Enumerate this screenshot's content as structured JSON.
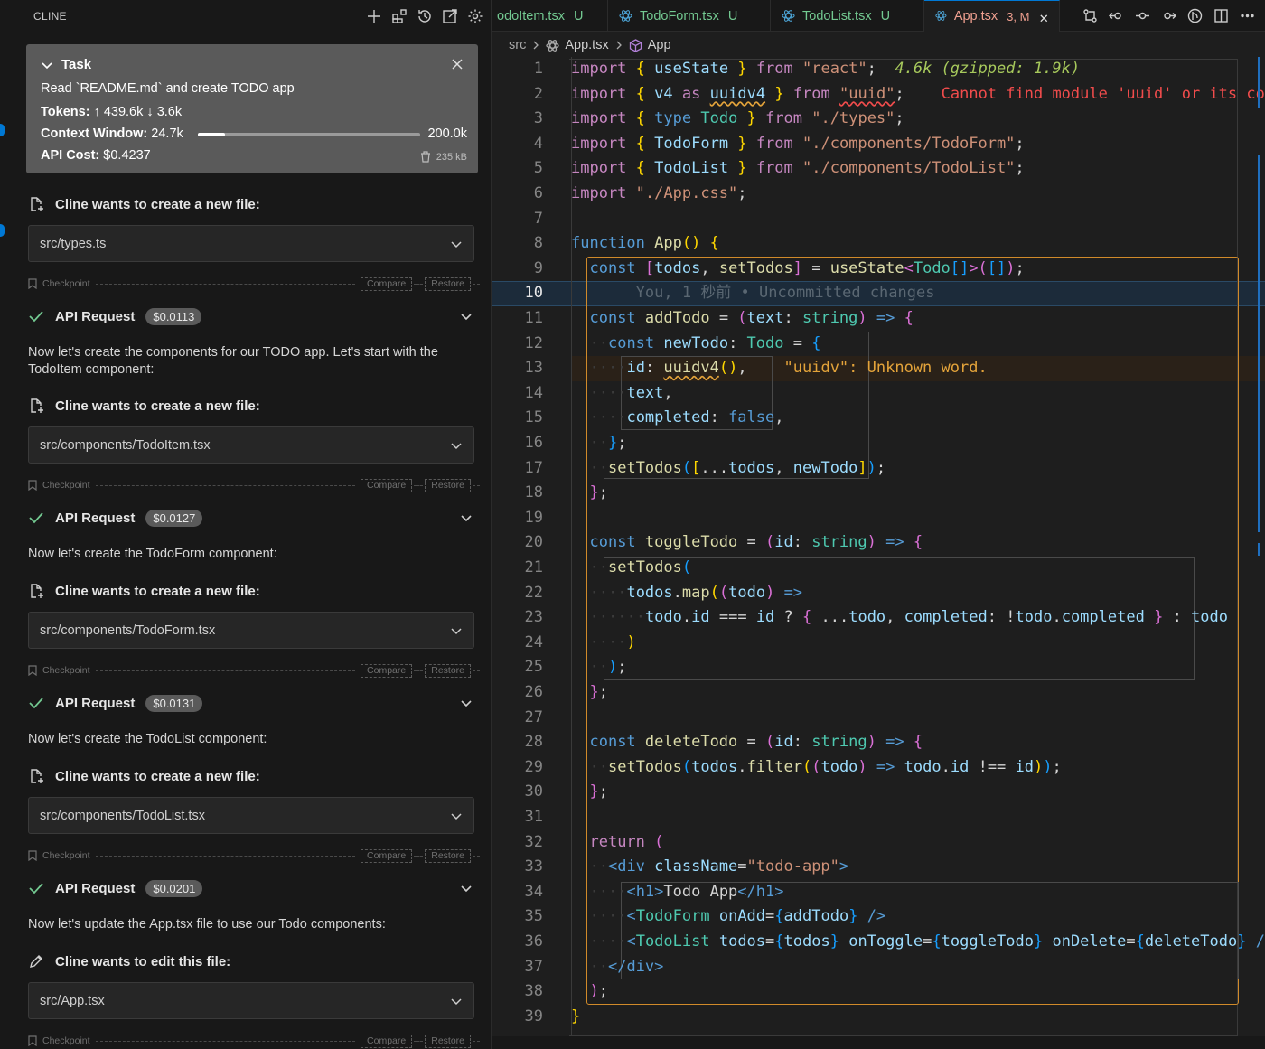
{
  "sidebar": {
    "title": "CLINE",
    "header_icons": [
      "plus-icon",
      "mcp-servers-icon",
      "history-icon",
      "popout-icon",
      "gear-icon"
    ],
    "task": {
      "title": "Task",
      "description": "Read `README.md` and create TODO app",
      "tokens_label": "Tokens:",
      "tokens_up": "↑ 439.6k",
      "tokens_down": "↓ 3.6k",
      "context_label": "Context Window:",
      "context_used": "24.7k",
      "context_max": "200.0k",
      "context_fraction": 0.1235,
      "cost_label": "API Cost:",
      "cost_value": "$0.4237",
      "storage_size": "235 kB"
    },
    "checkpoint": {
      "label": "Checkpoint",
      "compare": "Compare",
      "restore": "Restore"
    },
    "new_file_header": "Cline wants to create a new file:",
    "edit_file_header": "Cline wants to edit this file:",
    "files": [
      "src/types.ts",
      "src/components/TodoItem.tsx",
      "src/components/TodoForm.tsx",
      "src/components/TodoList.tsx",
      "src/App.tsx"
    ],
    "api_label": "API Request",
    "api_costs": [
      "$0.0113",
      "$0.0127",
      "$0.0131",
      "$0.0201"
    ],
    "messages": [
      "Now let's create the components for our TODO app. Let's start with the TodoItem component:",
      "Now let's create the TodoForm component:",
      "Now let's create the TodoList component:",
      "Now let's update the App.tsx file to use our Todo components:"
    ]
  },
  "editor": {
    "tabs": [
      {
        "label": "odoItem.tsx",
        "status": "U"
      },
      {
        "label": "TodoForm.tsx",
        "status": "U"
      },
      {
        "label": "TodoList.tsx",
        "status": "U"
      },
      {
        "label": "App.tsx",
        "status": "3, M"
      }
    ],
    "breadcrumb": {
      "folder": "src",
      "file": "App.tsx",
      "symbol": "App"
    },
    "current_line": 10,
    "inline": {
      "import_size": "4.6k (gzipped: 1.9k)",
      "uuid_error": "Cannot find module 'uuid' or its corres",
      "blame": "You, 1 秒前 • Uncommitted changes",
      "spell_warning": "\"uuidv\": Unknown word."
    }
  },
  "colors": {
    "accent": "#0078d4",
    "error": "#f14c4c",
    "warning": "#e3a33a",
    "success": "#73c991"
  }
}
